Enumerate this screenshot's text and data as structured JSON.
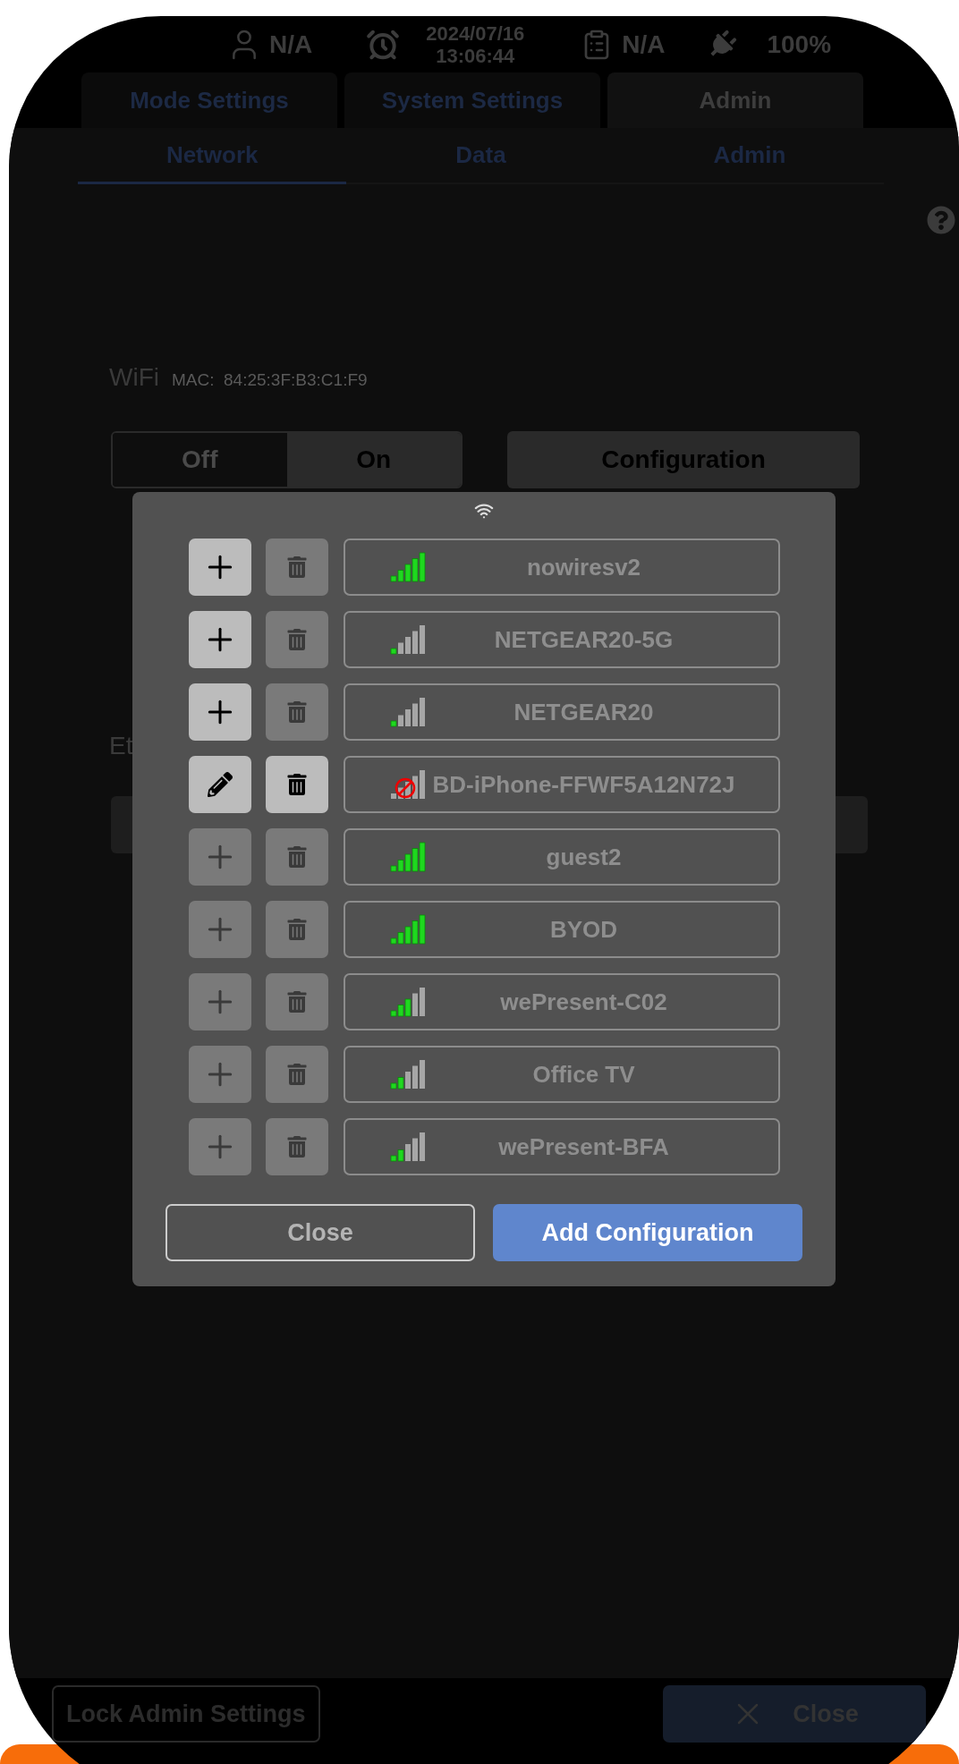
{
  "status_bar": {
    "user": "N/A",
    "date": "2024/07/16",
    "time": "13:06:44",
    "record": "N/A",
    "battery": "100%"
  },
  "tabs": [
    {
      "label": "Mode Settings",
      "selected": false
    },
    {
      "label": "System Settings",
      "selected": false
    },
    {
      "label": "Admin",
      "selected": true
    }
  ],
  "subtabs": [
    {
      "label": "Network",
      "selected": true
    },
    {
      "label": "Data",
      "selected": false
    },
    {
      "label": "Admin",
      "selected": false
    }
  ],
  "wifi": {
    "label": "WiFi",
    "mac": "MAC:  84:25:3F:B3:C1:F9",
    "toggle": [
      {
        "label": "Off",
        "selected": false
      },
      {
        "label": "On",
        "selected": true
      }
    ],
    "config_button": "Configuration"
  },
  "ethernet": {
    "label": "Et"
  },
  "dialog": {
    "networks": [
      {
        "name": "nowiresv2",
        "blocked": false,
        "bars": [
          {
            "lit": true
          },
          {
            "lit": true
          },
          {
            "lit": true
          },
          {
            "lit": true
          },
          {
            "lit": true
          }
        ],
        "kind": "add",
        "action_enabled": true,
        "delete_enabled": false
      },
      {
        "name": "NETGEAR20-5G",
        "blocked": false,
        "bars": [
          {
            "lit": true
          },
          {
            "lit": false
          },
          {
            "lit": false
          },
          {
            "lit": false
          },
          {
            "lit": false
          }
        ],
        "kind": "add",
        "action_enabled": true,
        "delete_enabled": false
      },
      {
        "name": "NETGEAR20",
        "blocked": false,
        "bars": [
          {
            "lit": true
          },
          {
            "lit": false
          },
          {
            "lit": false
          },
          {
            "lit": false
          },
          {
            "lit": false
          }
        ],
        "kind": "add",
        "action_enabled": true,
        "delete_enabled": false
      },
      {
        "name": "BD-iPhone-FFWF5A12N72J",
        "blocked": true,
        "bars": [
          {
            "lit": false
          },
          {
            "lit": false
          },
          {
            "lit": false
          },
          {
            "lit": false
          },
          {
            "lit": false
          }
        ],
        "kind": "edit",
        "action_enabled": true,
        "delete_enabled": true
      },
      {
        "name": "guest2",
        "blocked": false,
        "bars": [
          {
            "lit": true
          },
          {
            "lit": true
          },
          {
            "lit": true
          },
          {
            "lit": true
          },
          {
            "lit": true
          }
        ],
        "kind": "add",
        "action_enabled": false,
        "delete_enabled": false
      },
      {
        "name": "BYOD",
        "blocked": false,
        "bars": [
          {
            "lit": true
          },
          {
            "lit": true
          },
          {
            "lit": true
          },
          {
            "lit": true
          },
          {
            "lit": true
          }
        ],
        "kind": "add",
        "action_enabled": false,
        "delete_enabled": false
      },
      {
        "name": "wePresent-C02",
        "blocked": false,
        "bars": [
          {
            "lit": true
          },
          {
            "lit": true
          },
          {
            "lit": true
          },
          {
            "lit": false
          },
          {
            "lit": false
          }
        ],
        "kind": "add",
        "action_enabled": false,
        "delete_enabled": false
      },
      {
        "name": "Office TV",
        "blocked": false,
        "bars": [
          {
            "lit": true
          },
          {
            "lit": true
          },
          {
            "lit": false
          },
          {
            "lit": false
          },
          {
            "lit": false
          }
        ],
        "kind": "add",
        "action_enabled": false,
        "delete_enabled": false
      },
      {
        "name": "wePresent-BFA",
        "blocked": false,
        "bars": [
          {
            "lit": true
          },
          {
            "lit": true
          },
          {
            "lit": false
          },
          {
            "lit": false
          },
          {
            "lit": false
          }
        ],
        "kind": "add",
        "action_enabled": false,
        "delete_enabled": false
      }
    ],
    "close_button": "Close",
    "add_button": "Add Configuration"
  },
  "footer": {
    "lock_button": "Lock Admin Settings",
    "close_button": "Close"
  }
}
